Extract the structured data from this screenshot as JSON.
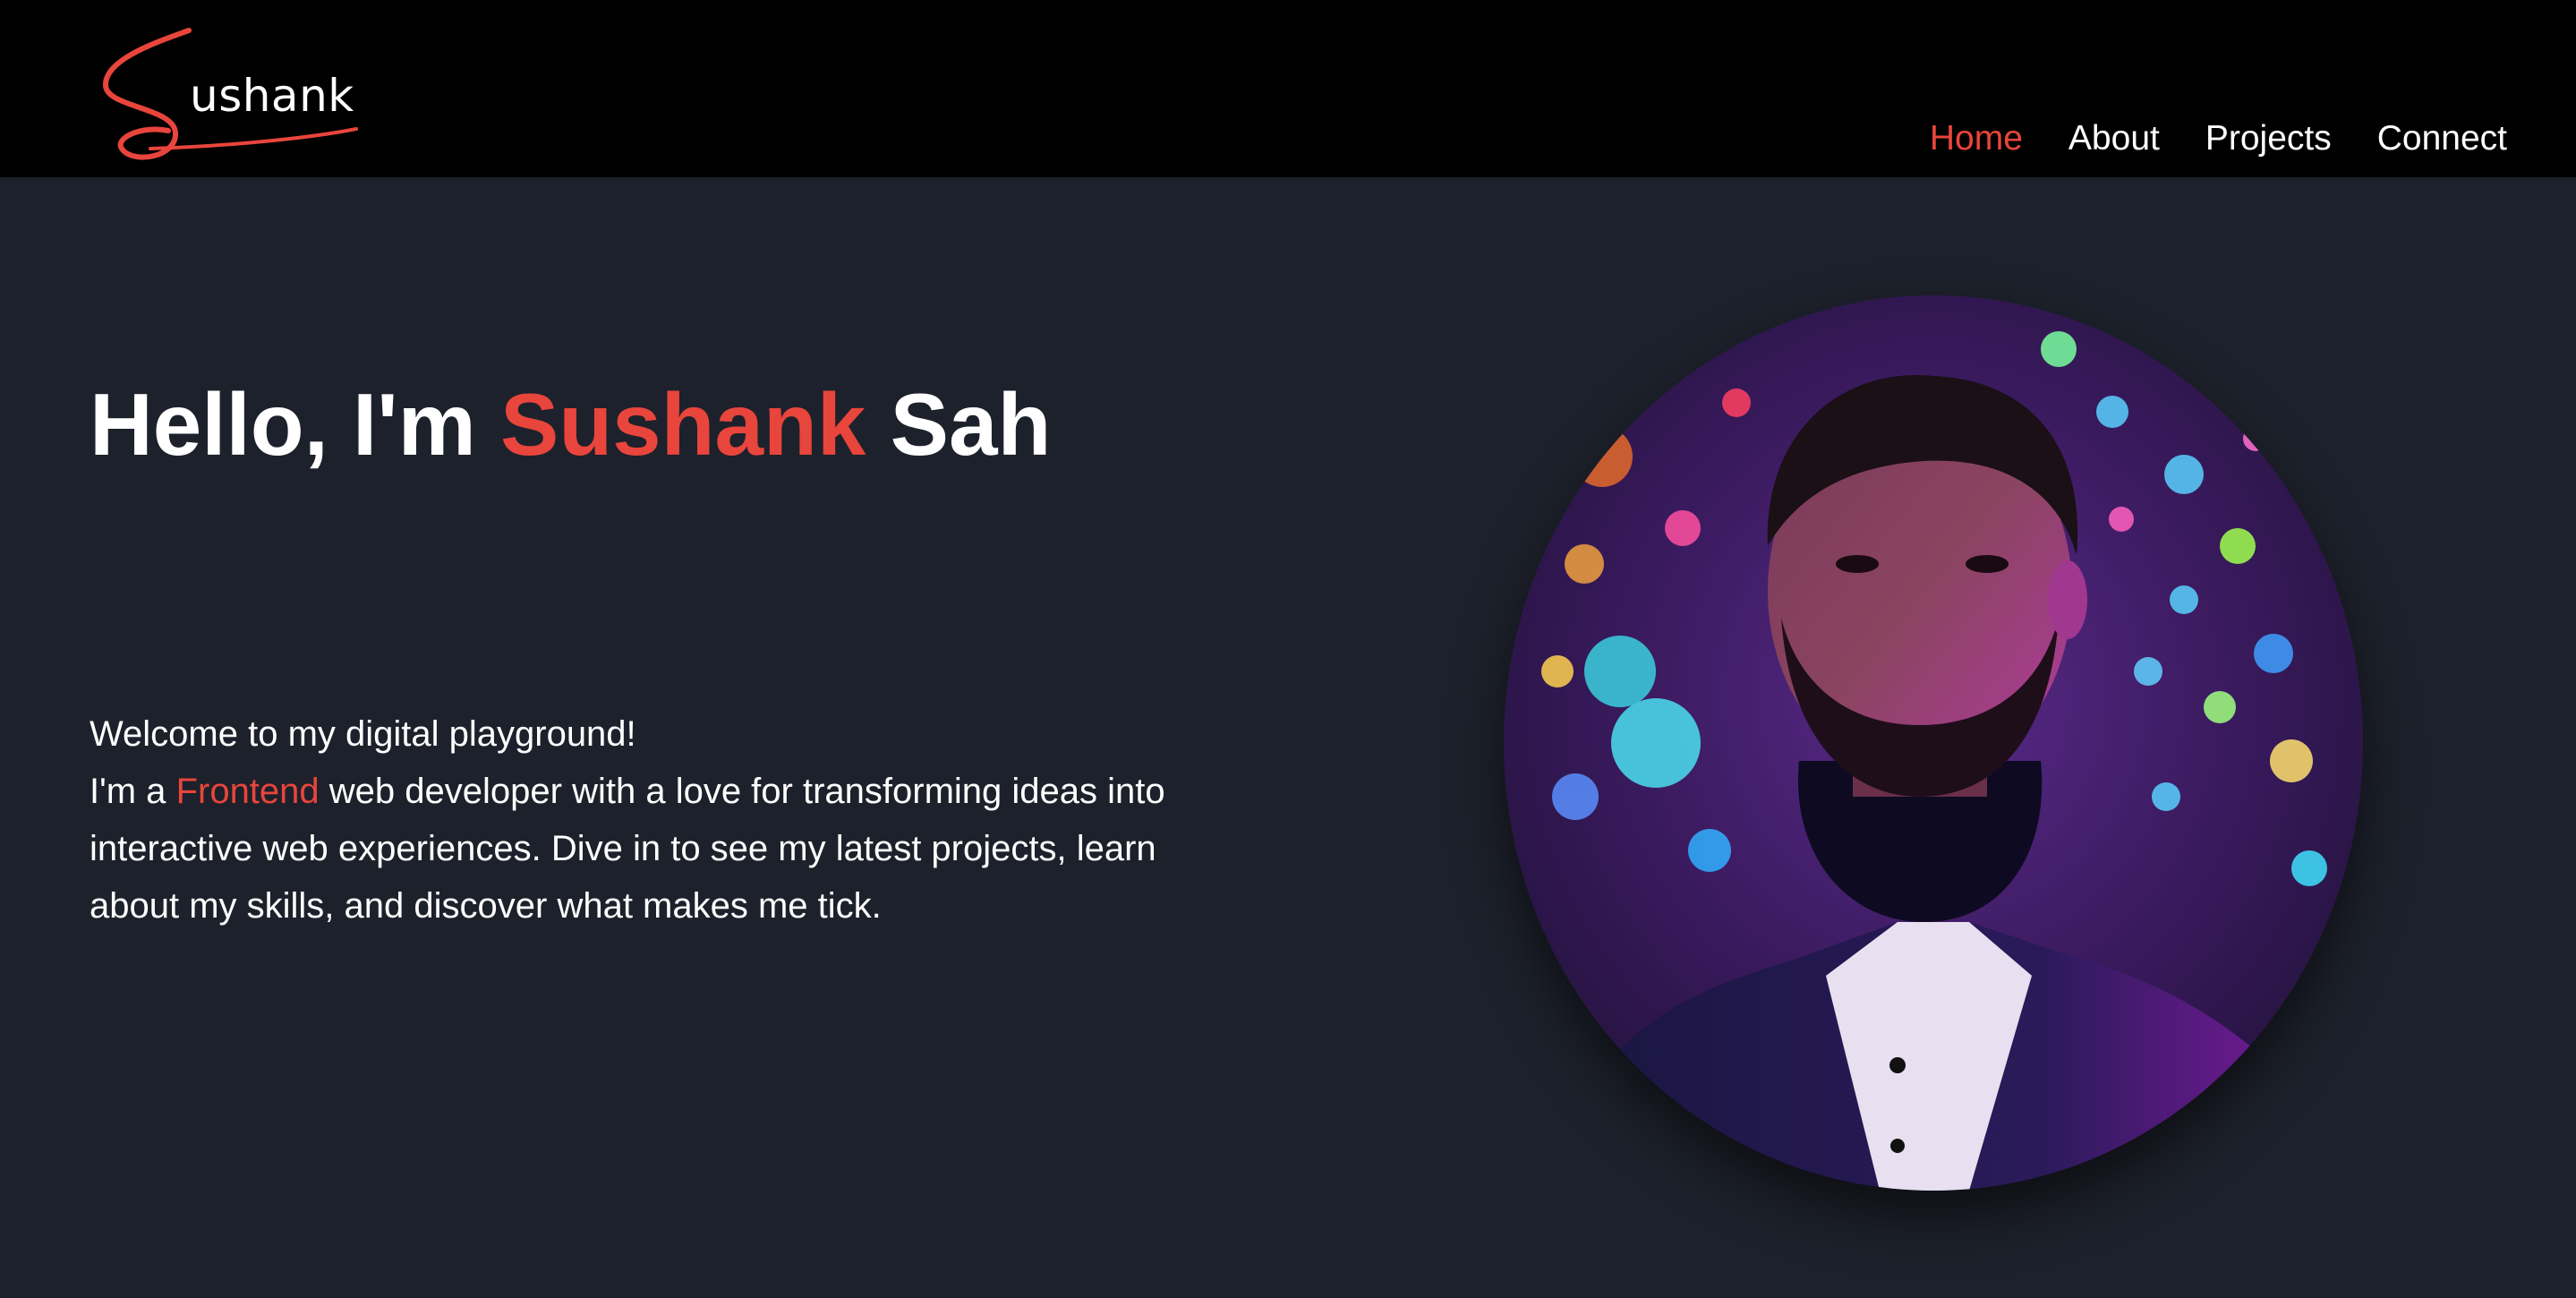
{
  "header": {
    "logo": {
      "text": "ushank",
      "initial": "S",
      "accent_color": "#e8453c"
    },
    "nav": [
      {
        "label": "Home",
        "active": true
      },
      {
        "label": "About",
        "active": false
      },
      {
        "label": "Projects",
        "active": false
      },
      {
        "label": "Connect",
        "active": false
      }
    ]
  },
  "hero": {
    "title_prefix": "Hello, I'm",
    "title_highlight": "Sushank",
    "title_suffix": "Sah",
    "line1": "Welcome to my digital playground!",
    "line2_prefix": "I'm a",
    "line2_highlight": "Frontend",
    "line2_rest": "web developer with a love for transforming ideas into interactive web experiences. Dive in to see my latest projects, learn about my skills, and discover what makes me tick."
  },
  "colors": {
    "accent": "#e8453c",
    "background": "#1d212b",
    "header_bg": "#000000"
  }
}
